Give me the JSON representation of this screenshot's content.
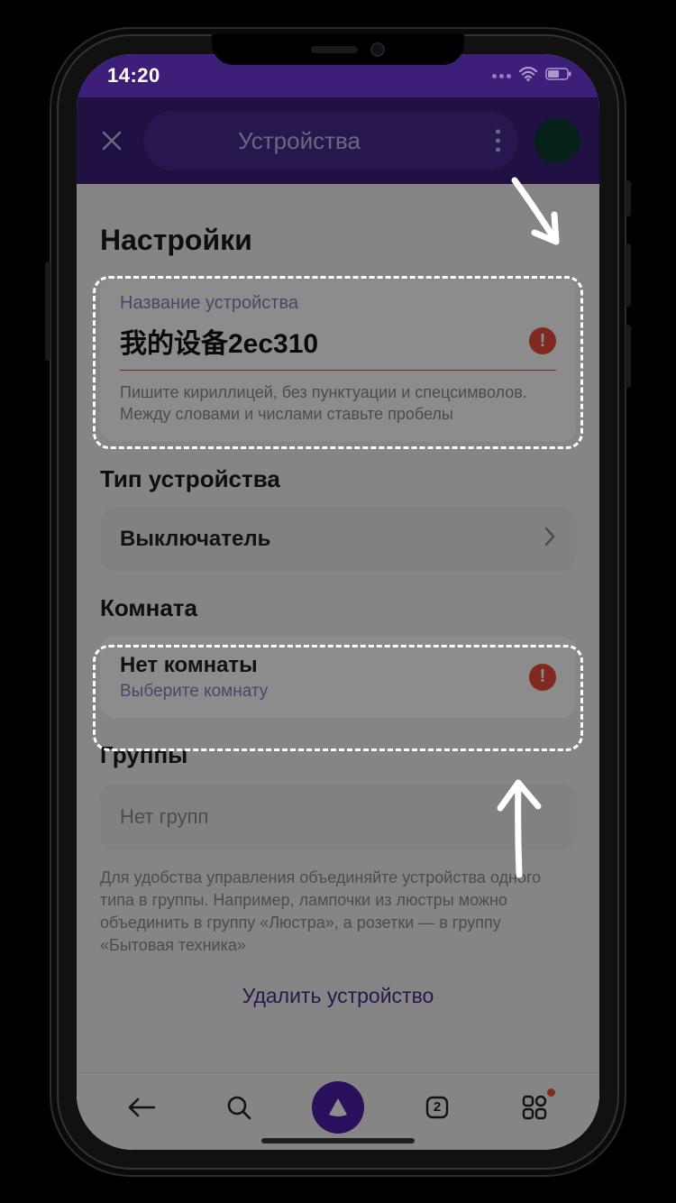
{
  "status": {
    "time": "14:20"
  },
  "header": {
    "title": "Устройства"
  },
  "settings_heading": "Настройки",
  "device_name": {
    "label": "Название устройства",
    "value": "我的设备2ec310",
    "hint": "Пишите кириллицей, без пунктуации и спецсимволов. Между словами и числами ставьте пробелы"
  },
  "device_type": {
    "heading": "Тип устройства",
    "value": "Выключатель"
  },
  "room": {
    "heading": "Комната",
    "title": "Нет комнаты",
    "subtitle": "Выберите комнату"
  },
  "groups": {
    "heading": "Группы",
    "empty": "Нет групп",
    "hint": "Для удобства управления объединяйте устройства одного типа в группы. Например, лампочки из люстры можно объединить в группу «Люстра», а розетки — в группу «Бытовая техника»"
  },
  "delete_label": "Удалить устройство",
  "tabs_count": "2"
}
